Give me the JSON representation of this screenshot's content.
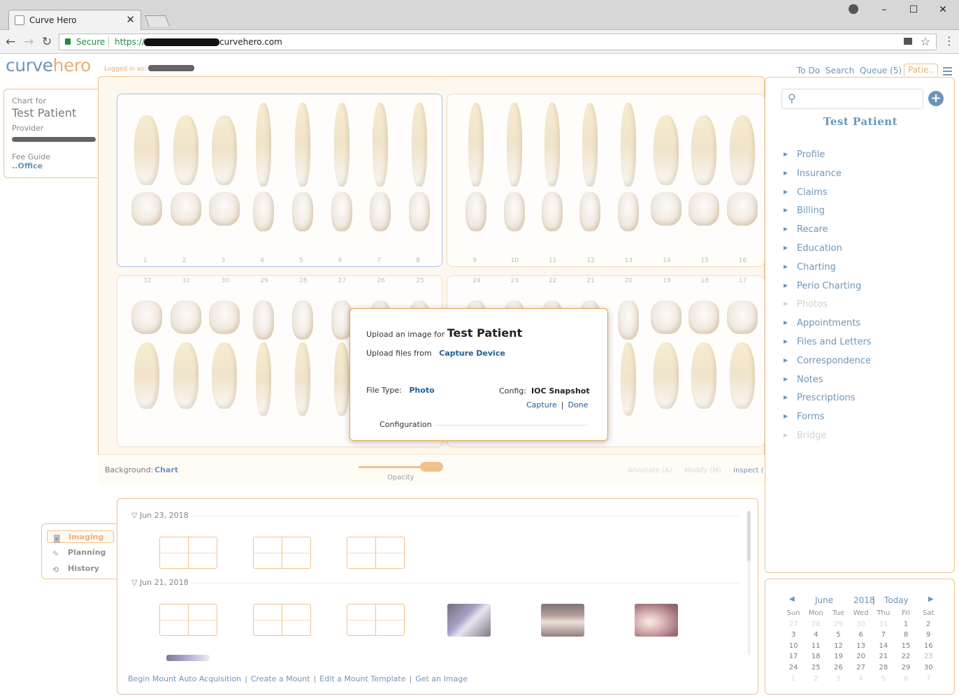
{
  "browser": {
    "tab_title": "Curve Hero",
    "secure_label": "Secure",
    "url_scheme": "https://",
    "url_host": "curvehero.com",
    "window_controls": [
      "minimize-icon",
      "maximize-icon",
      "close-icon"
    ]
  },
  "header": {
    "logo_part1": "curve",
    "logo_part2": "hero",
    "logged_in_label": "Logged in as:",
    "nav": {
      "todo": "To Do",
      "search": "Search",
      "queue": "Queue (5)",
      "patient_tab": "Patie.."
    }
  },
  "chart_card": {
    "chart_for_label": "Chart for",
    "patient_name": "Test Patient",
    "provider_label": "Provider",
    "fee_guide_label": "Fee Guide",
    "fee_guide_value": "..Office"
  },
  "teeth": {
    "upper_right": [
      "1",
      "2",
      "3",
      "4",
      "5",
      "6",
      "7",
      "8"
    ],
    "upper_left": [
      "9",
      "10",
      "11",
      "12",
      "13",
      "14",
      "15",
      "16"
    ],
    "lower_right": [
      "32",
      "31",
      "30",
      "29",
      "28",
      "27",
      "26",
      "25"
    ],
    "lower_left": [
      "24",
      "23",
      "22",
      "21",
      "20",
      "19",
      "18",
      "17"
    ]
  },
  "toolbar": {
    "background_label": "Background:",
    "background_value": "Chart",
    "opacity_label": "Opacity",
    "opacity_level": 0.85,
    "annotate": "Annotate (A)",
    "modify": "Modify (M)",
    "inspect": "Inspect ("
  },
  "subnav": {
    "imaging": "Imaging",
    "planning": "Planning",
    "history": "History"
  },
  "gallery": {
    "groups": [
      {
        "date": "Jun 23, 2018"
      },
      {
        "date": "Jun 21, 2018"
      }
    ],
    "links": [
      "Begin Mount Auto Acquisition",
      "Create a Mount",
      "Edit a Mount Template",
      "Get an Image"
    ]
  },
  "right_panel": {
    "search_placeholder": "",
    "patient_name": "Test Patient",
    "items": [
      {
        "label": "Profile",
        "enabled": true
      },
      {
        "label": "Insurance",
        "enabled": true
      },
      {
        "label": "Claims",
        "enabled": true
      },
      {
        "label": "Billing",
        "enabled": true
      },
      {
        "label": "Recare",
        "enabled": true
      },
      {
        "label": "Education",
        "enabled": true
      },
      {
        "label": "Charting",
        "enabled": true
      },
      {
        "label": "Perio Charting",
        "enabled": true
      },
      {
        "label": "Photos",
        "enabled": false
      },
      {
        "label": "Appointments",
        "enabled": true
      },
      {
        "label": "Files and Letters",
        "enabled": true
      },
      {
        "label": "Correspondence",
        "enabled": true
      },
      {
        "label": "Notes",
        "enabled": true
      },
      {
        "label": "Prescriptions",
        "enabled": true
      },
      {
        "label": "Forms",
        "enabled": true
      },
      {
        "label": "Bridge",
        "enabled": false
      }
    ]
  },
  "calendar": {
    "month": "June",
    "year": "2018",
    "today_label": "Today",
    "day_headers": [
      "Sun",
      "Mon",
      "Tue",
      "Wed",
      "Thu",
      "Fri",
      "Sat"
    ],
    "weeks": [
      [
        "27",
        "28",
        "29",
        "30",
        "31",
        "1",
        "2"
      ],
      [
        "3",
        "4",
        "5",
        "6",
        "7",
        "8",
        "9"
      ],
      [
        "10",
        "11",
        "12",
        "13",
        "14",
        "15",
        "16"
      ],
      [
        "17",
        "18",
        "19",
        "20",
        "21",
        "22",
        "23"
      ],
      [
        "24",
        "25",
        "26",
        "27",
        "28",
        "29",
        "30"
      ],
      [
        "1",
        "2",
        "3",
        "4",
        "5",
        "6",
        "7"
      ]
    ],
    "today": "23",
    "accent_color": "#e07a1f"
  },
  "modal": {
    "upload_label": "Upload an image for",
    "patient_name": "Test Patient",
    "upload_from_label": "Upload files from",
    "upload_from_value": "Capture Device",
    "file_type_label": "File Type:",
    "file_type_value": "Photo",
    "config_label": "Config:",
    "config_value": "IOC Snapshot",
    "capture": "Capture",
    "done": "Done",
    "configuration_label": "Configuration"
  },
  "colors": {
    "brand_blue": "#1f5d94",
    "brand_orange": "#e8a050"
  }
}
